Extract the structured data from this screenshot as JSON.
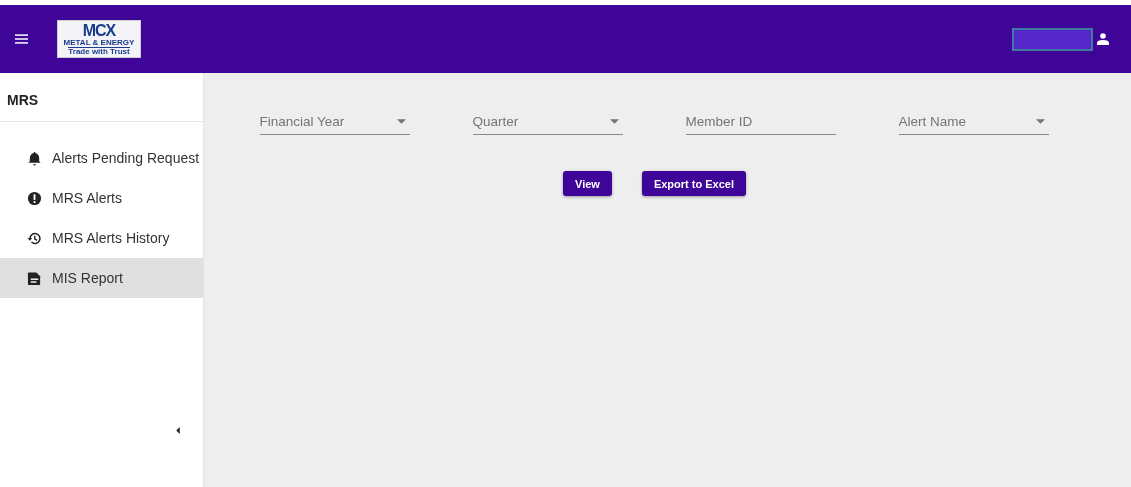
{
  "header": {
    "logo": {
      "brand": "MCX",
      "line1": "METAL & ENERGY",
      "line2": "Trade with Trust"
    }
  },
  "sidebar": {
    "title": "MRS",
    "items": [
      {
        "label": "Alerts Pending Request",
        "kind": "bell",
        "selected": false
      },
      {
        "label": "MRS Alerts",
        "kind": "alert",
        "selected": false
      },
      {
        "label": "MRS Alerts History",
        "kind": "history",
        "selected": false
      },
      {
        "label": "MIS Report",
        "kind": "document",
        "selected": true
      }
    ]
  },
  "filters": [
    {
      "placeholder": "Financial Year",
      "kind": "select"
    },
    {
      "placeholder": "Quarter",
      "kind": "select"
    },
    {
      "placeholder": "Member ID",
      "kind": "text"
    },
    {
      "placeholder": "Alert Name",
      "kind": "select"
    }
  ],
  "buttons": [
    "View",
    "Export to Excel"
  ]
}
